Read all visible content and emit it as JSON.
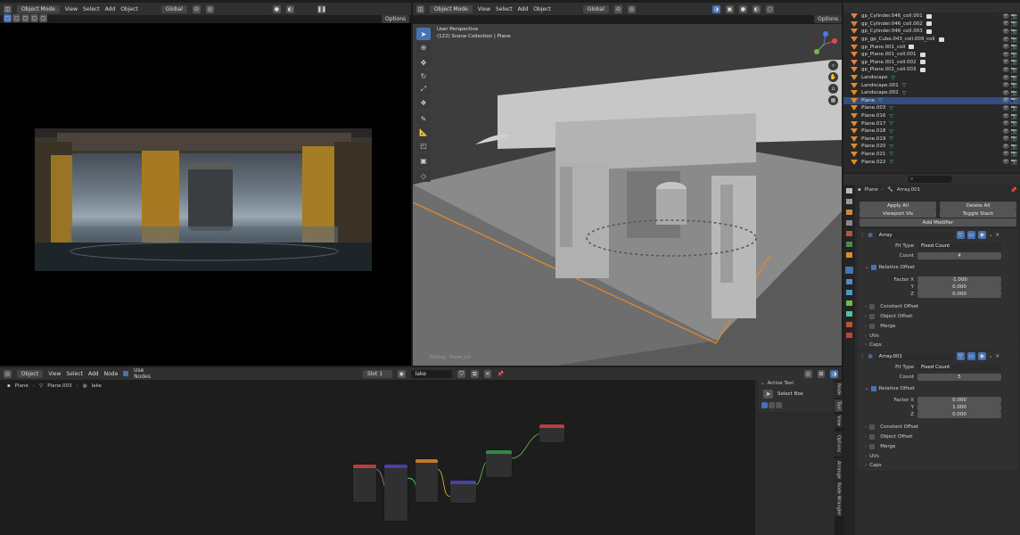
{
  "left_header": {
    "mode": "Object Mode",
    "menus": [
      "View",
      "Select",
      "Add",
      "Object"
    ],
    "transform": "Global",
    "options": "Options"
  },
  "right_header": {
    "mode": "Object Mode",
    "menus": [
      "View",
      "Select",
      "Add",
      "Object"
    ],
    "transform": "Global",
    "options": "Options"
  },
  "viewport": {
    "perspective": "User Perspective",
    "collection": "(122) Scene Collection | Plane",
    "editing": "Editing : Plane_col"
  },
  "outliner": {
    "items": [
      {
        "name": "gp_Cylinder.046_coll.001",
        "type": "obj"
      },
      {
        "name": "gp_Cylinder.046_coll.002",
        "type": "obj"
      },
      {
        "name": "gp_Cylinder.046_coll.003",
        "type": "obj"
      },
      {
        "name": "gp_gp_Cube.043_coll.009_coll",
        "type": "obj"
      },
      {
        "name": "gp_Plane.001_coll",
        "type": "obj"
      },
      {
        "name": "gp_Plane.001_coll.001",
        "type": "obj"
      },
      {
        "name": "gp_Plane.001_coll.002",
        "type": "obj"
      },
      {
        "name": "gp_Plane.001_coll.003",
        "type": "obj"
      },
      {
        "name": "Landscape",
        "type": "mesh"
      },
      {
        "name": "Landscape.001",
        "type": "mesh"
      },
      {
        "name": "Landscape.002",
        "type": "mesh"
      },
      {
        "name": "Plane",
        "type": "mesh",
        "selected": true
      },
      {
        "name": "Plane.003",
        "type": "mesh"
      },
      {
        "name": "Plane.016",
        "type": "mesh"
      },
      {
        "name": "Plane.017",
        "type": "mesh"
      },
      {
        "name": "Plane.018",
        "type": "mesh"
      },
      {
        "name": "Plane.019",
        "type": "mesh"
      },
      {
        "name": "Plane.020",
        "type": "mesh"
      },
      {
        "name": "Plane.021",
        "type": "mesh"
      },
      {
        "name": "Plane.022",
        "type": "mesh"
      }
    ]
  },
  "properties": {
    "breadcrumb_obj": "Plane",
    "breadcrumb_mod": "Array.001",
    "apply_all": "Apply All",
    "delete_all": "Delete All",
    "viewport_vis": "Viewport Vis",
    "toggle_stack": "Toggle Stack",
    "add_modifier": "Add Modifier",
    "mod1": {
      "name": "Array",
      "fit_type_label": "Fit Type",
      "fit_type": "Fixed Count",
      "count_label": "Count",
      "count": "4",
      "relative_offset": "Relative Offset",
      "factor_x_label": "Factor X",
      "factor_x": "-1.000",
      "y_label": "Y",
      "y": "0.000",
      "z_label": "Z",
      "z": "0.000",
      "constant_offset": "Constant Offset",
      "object_offset": "Object Offset",
      "merge": "Merge",
      "uvs": "UVs",
      "caps": "Caps"
    },
    "mod2": {
      "name": "Array.001",
      "fit_type_label": "Fit Type",
      "fit_type": "Fixed Count",
      "count_label": "Count",
      "count": "5",
      "relative_offset": "Relative Offset",
      "factor_x_label": "Factor X",
      "factor_x": "0.000",
      "y_label": "Y",
      "y": "1.000",
      "z_label": "Z",
      "z": "0.000",
      "constant_offset": "Constant Offset",
      "object_offset": "Object Offset",
      "merge": "Merge",
      "uvs": "UVs",
      "caps": "Caps"
    }
  },
  "node_editor": {
    "type": "Object",
    "menus": [
      "View",
      "Select",
      "Add",
      "Node"
    ],
    "use_nodes": "Use Nodes",
    "slot": "Slot 1",
    "material": "lake",
    "breadcrumb": [
      "Plane",
      "Plane.003",
      "lake"
    ],
    "active_tool": "Active Tool",
    "select_box": "Select Box",
    "tabs": [
      "Node",
      "Tool",
      "View",
      "Options",
      "Arrange",
      "Node Wrangler"
    ]
  },
  "colors": {
    "accent": "#4772b3",
    "selection": "#334d80",
    "orange": "#e08a2c"
  }
}
